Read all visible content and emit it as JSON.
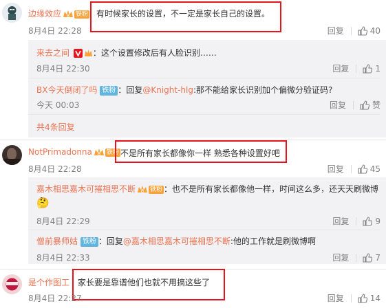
{
  "comments": [
    {
      "user": "边缘效应",
      "fan_badge": "铁粉",
      "text": "有时候家长的设置，不一定是家长自己的设置。",
      "time": "8月4日 22:28",
      "reply_label": "回复",
      "likes": "40",
      "replies": [
        {
          "user": "来去之间",
          "text": "这个设置修改后有人脸识别……",
          "time": "8月4日 22:30",
          "reply_label": "回复",
          "likes": "1"
        },
        {
          "user": "BX今天倒闭了吗",
          "tag": "铁粉",
          "reply_prefix": "回复",
          "mention": "@Knight-hlg",
          "text": "那不能给家长识别加个偏微分验证码?",
          "time": "今天 00:03",
          "reply_label": "回复",
          "likes": "赞"
        }
      ],
      "more": "共4条回复"
    },
    {
      "user": "NotPrimadonna",
      "fan_badge": "铁粉",
      "text": "不是所有家长都像你一样 熟悉各种设置好吧",
      "time": "8月4日 22:28",
      "reply_label": "回复",
      "likes": "45",
      "replies": [
        {
          "user": "嘉木相思嘉木可摧相思不断",
          "fan_badge": "铁粉",
          "text": "也不是所有家长都像他一样，时间这么多，还天天刷微博",
          "emoji": "🤔",
          "time": "8月4日 22:29",
          "reply_label": "回复",
          "likes": "9"
        },
        {
          "user": "僧前暴师姑",
          "tag": "铁粉",
          "reply_prefix": "回复",
          "mention": "@嘉木相思嘉木可摧相思不断",
          "text": "他的工作就是刷微博啊",
          "time": "8月4日 22:33",
          "reply_label": "回复",
          "likes": "7"
        }
      ]
    },
    {
      "user": "是个作图工",
      "text": "家长要是靠谱他们也就不用搞这些了",
      "time": "8月4日 22:27",
      "reply_label": "回复",
      "likes": "14"
    }
  ],
  "colors": {
    "username": "#eb7350",
    "highlight_box": "#e8141b",
    "reply_bg": "#f2f2f5",
    "fan_badge": "#f7a23a",
    "tag": "#5fb5e0"
  }
}
